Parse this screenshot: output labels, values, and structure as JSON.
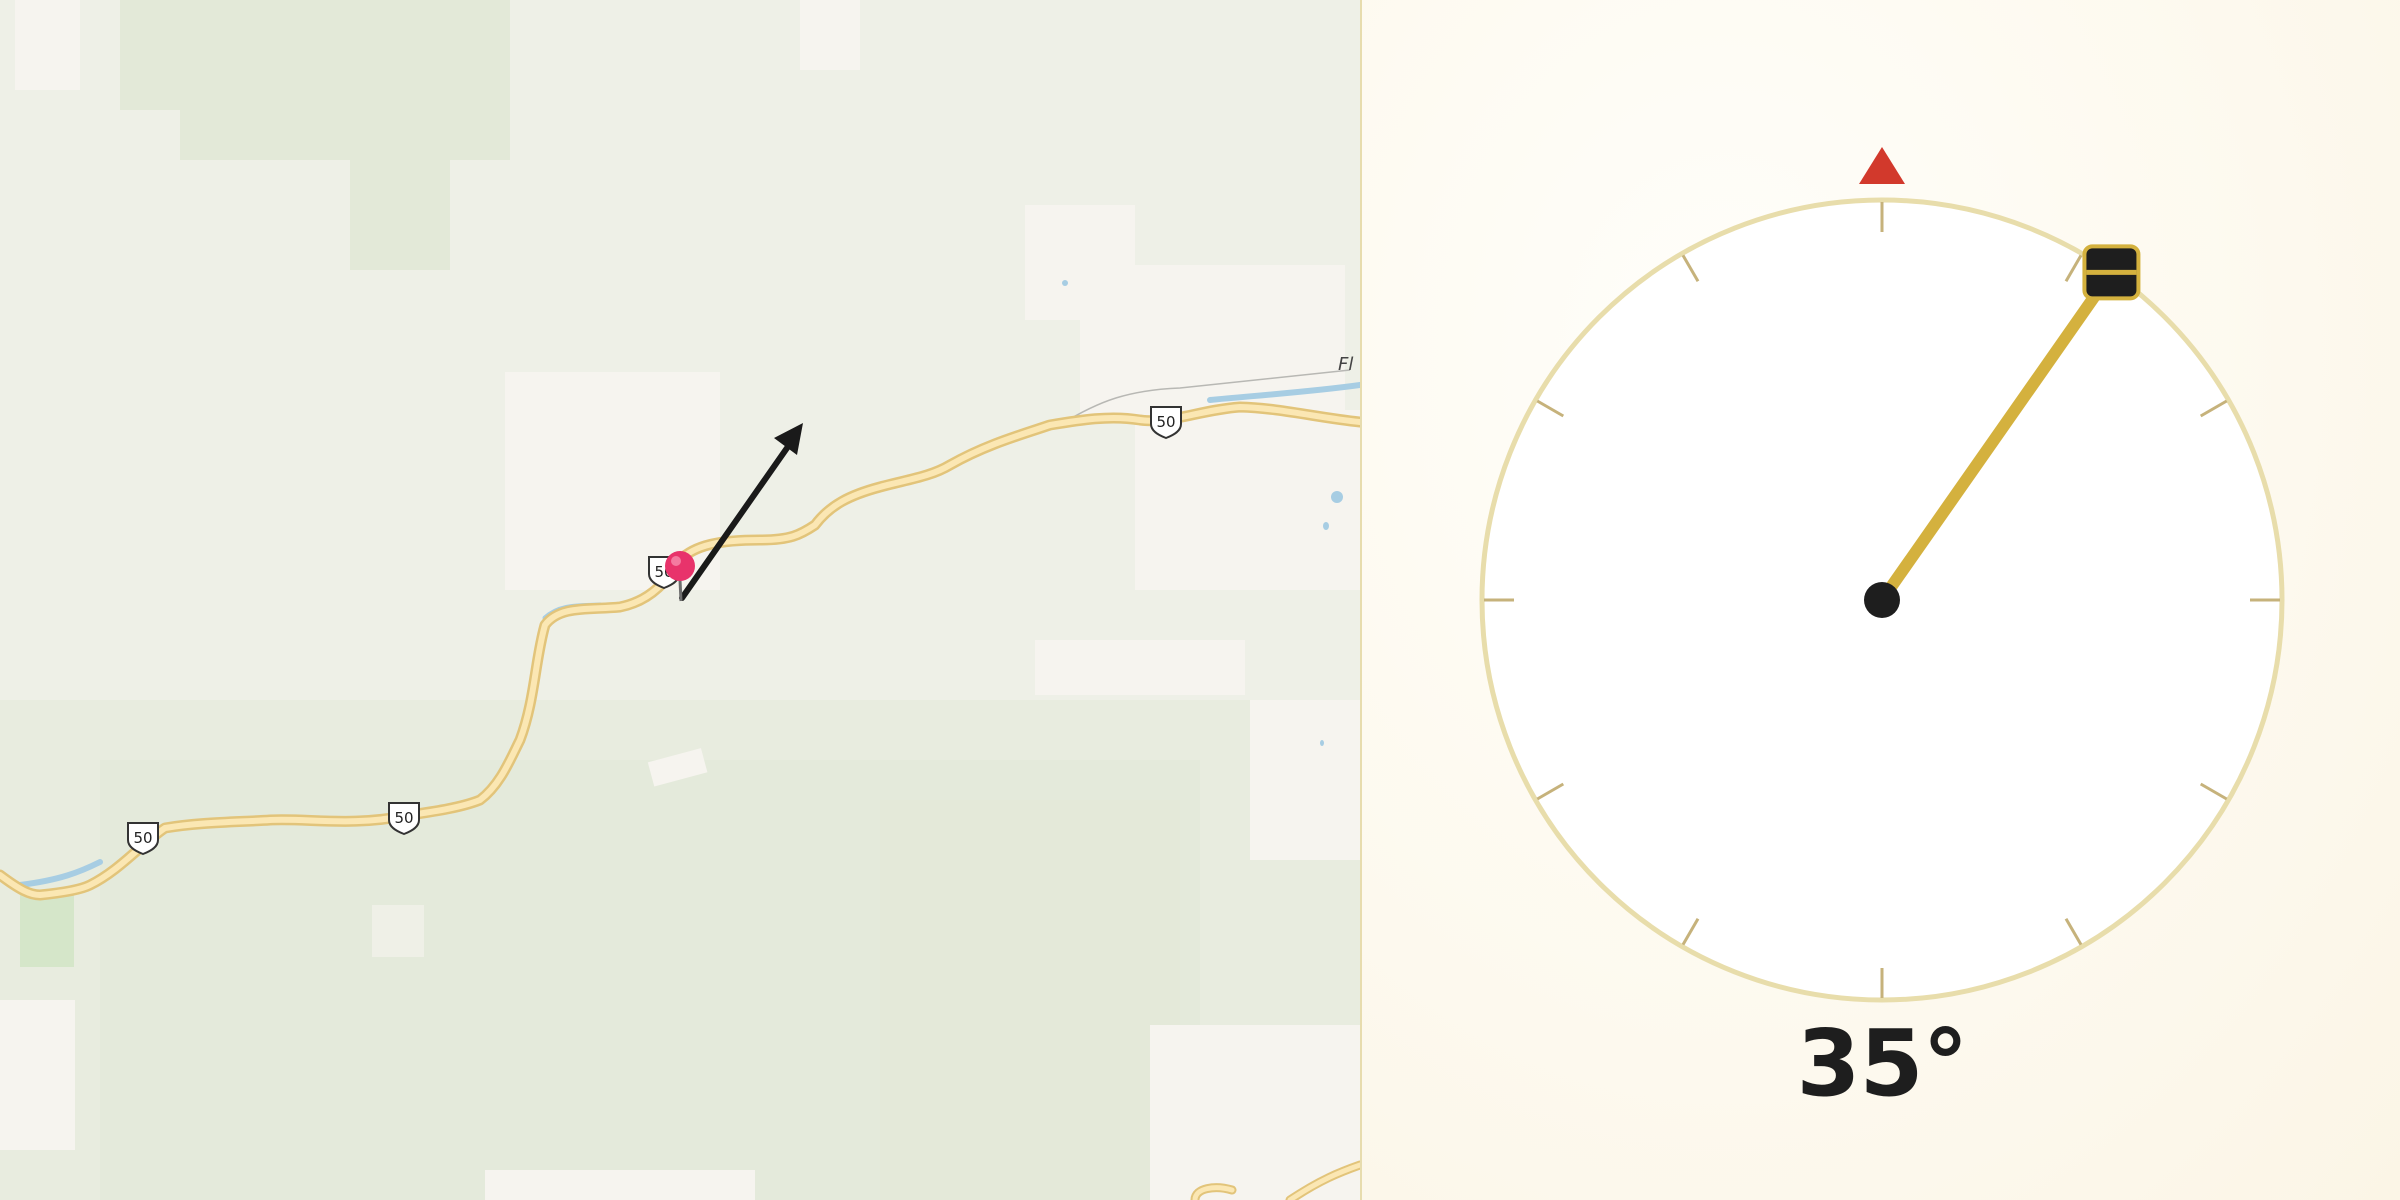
{
  "map": {
    "route_shields": [
      "50",
      "50",
      "50",
      "50"
    ],
    "road_label": "Fl",
    "colors": {
      "background": "#eeefe6",
      "forest": "#e4e9d9",
      "clearing": "#f5f3ee",
      "road_casing": "#e5c77e",
      "road_fill": "#fbe7b3",
      "river": "#a7cde3",
      "park": "#d5e6c9"
    },
    "marker": {
      "icon": "map-pin-icon",
      "color": "#e8336b"
    },
    "direction_arrow": {
      "icon": "direction-arrow-icon",
      "color": "#1a1a1a"
    }
  },
  "compass": {
    "heading_deg": 35,
    "heading_label": "35°",
    "north_icon": "north-triangle-icon",
    "handle_icon": "drag-handle-icon",
    "colors": {
      "ring": "#e5d9a2",
      "tick": "#c6b27b",
      "needle": "#d4b13e",
      "north": "#d2392c",
      "pivot": "#1e1e1e",
      "handle": "#1e1e1e"
    }
  }
}
